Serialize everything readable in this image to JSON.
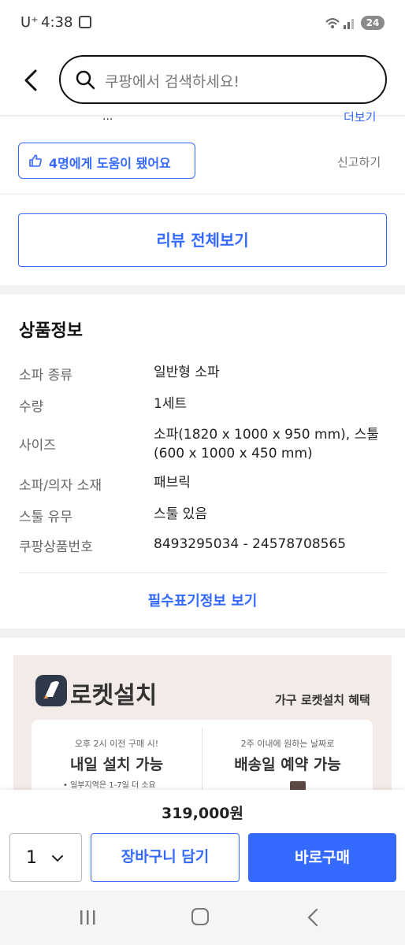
{
  "status_bar": {
    "carrier": "U⁺",
    "time": "4:38",
    "battery": "24"
  },
  "header": {
    "search_placeholder": "쿠팡에서 검색하세요!"
  },
  "review": {
    "cut_text": "...",
    "cut_more": "더보기",
    "helpful_label": "4명에게 도움이 됐어요",
    "report_label": "신고하기",
    "all_reviews_label": "리뷰 전체보기"
  },
  "product_info": {
    "title": "상품정보",
    "rows": [
      {
        "label": "소파 종류",
        "value": "일반형 소파"
      },
      {
        "label": "수량",
        "value": "1세트"
      },
      {
        "label": "사이즈",
        "value": "소파(1820 x 1000 x 950 mm), 스툴(600 x 1000 x 450 mm)"
      },
      {
        "label": "소파/의자 소재",
        "value": "패브릭"
      },
      {
        "label": "스툴 유무",
        "value": "스툴 있음"
      },
      {
        "label": "쿠팡상품번호",
        "value": "8493295034 - 24578708565"
      }
    ],
    "mandatory_link": "필수표기정보 보기"
  },
  "banner": {
    "title": "로켓설치",
    "benefit": "가구 로켓설치 혜택",
    "col1_sub": "오후 2시 이전 구매 시!",
    "col1_main": "내일 설치 가능",
    "col1_note": "• 일부지역은 1-7일 더 소요",
    "col2_sub": "2주 이내에 원하는 날짜로",
    "col2_main": "배송일 예약 가능"
  },
  "purchase": {
    "price": "319,000원",
    "quantity": "1",
    "cart_label": "장바구니 담기",
    "buy_label": "바로구매"
  },
  "colors": {
    "accent": "#346aff",
    "banner_bg": "#f3ebe7"
  }
}
